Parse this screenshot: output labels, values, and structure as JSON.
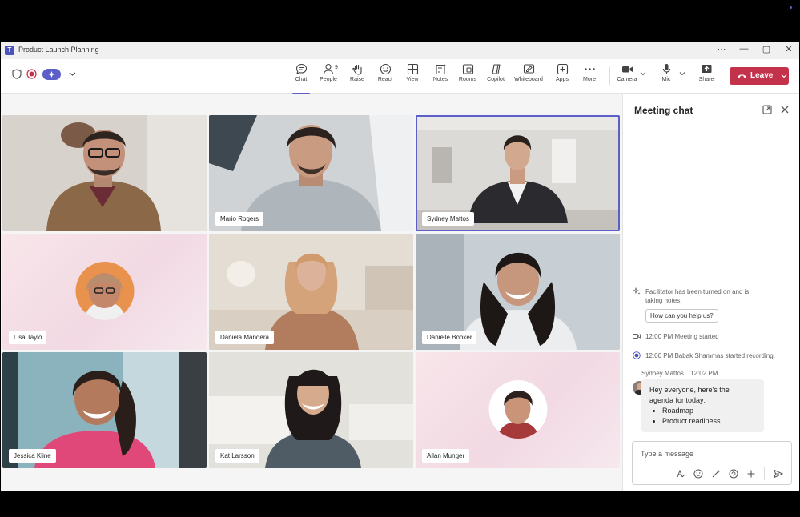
{
  "window": {
    "title": "Product Launch Planning",
    "controls": [
      "⋯",
      "—",
      "▢",
      "✕"
    ]
  },
  "toolbar": {
    "buttons": [
      {
        "label": "Chat",
        "icon": "chat-icon"
      },
      {
        "label": "People",
        "icon": "people-icon",
        "badge": "9"
      },
      {
        "label": "Raise",
        "icon": "raise-hand-icon"
      },
      {
        "label": "React",
        "icon": "react-icon"
      },
      {
        "label": "View",
        "icon": "view-icon"
      },
      {
        "label": "Notes",
        "icon": "notes-icon"
      },
      {
        "label": "Rooms",
        "icon": "rooms-icon"
      },
      {
        "label": "Copilot",
        "icon": "copilot-icon"
      },
      {
        "label": "Whiteboard",
        "icon": "whiteboard-icon"
      },
      {
        "label": "Apps",
        "icon": "apps-icon"
      },
      {
        "label": "More",
        "icon": "more-icon"
      },
      {
        "label": "Camera",
        "icon": "camera-icon"
      },
      {
        "label": "Mic",
        "icon": "mic-icon"
      },
      {
        "label": "Share",
        "icon": "share-icon"
      }
    ],
    "leave_label": "Leave",
    "accent": "#5b5fc7",
    "leave_color": "#c4314b"
  },
  "participants": [
    {
      "name": ""
    },
    {
      "name": "Mario Rogers"
    },
    {
      "name": "Sydney Mattos"
    },
    {
      "name": "Lisa Taylo"
    },
    {
      "name": "Daniela Mandera"
    },
    {
      "name": "Danielle Booker"
    },
    {
      "name": "Jessica Kline"
    },
    {
      "name": "Kat Larsson"
    },
    {
      "name": "Allan Munger"
    }
  ],
  "chat": {
    "title": "Meeting chat",
    "facilitator_line1": "Facilitator has been turned on and is",
    "facilitator_line2": "taking notes.",
    "help_button": "How can you help us?",
    "meeting_started": "12:00 PM  Meeting started",
    "recording_started": "12:00 PM  Babak Shammas started recording.",
    "message": {
      "sender": "Sydney Mattos",
      "time": "12:02 PM",
      "line1": "Hey everyone, here's the",
      "line2": "agenda for today:",
      "items": [
        "Roadmap",
        "Product readiness"
      ]
    },
    "compose_placeholder": "Type a message"
  }
}
